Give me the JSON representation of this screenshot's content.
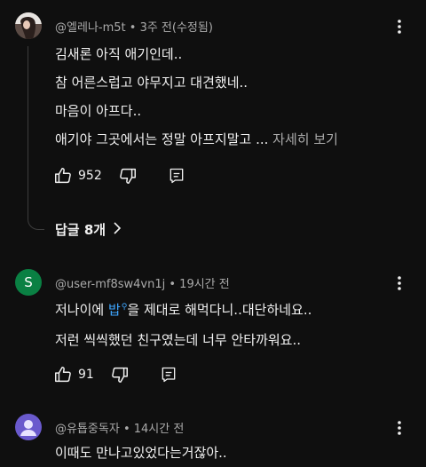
{
  "comments": [
    {
      "author": "@엘레나-m5t",
      "separator": "•",
      "time": "3주 전(수정됨)",
      "lines": [
        "김새론 아직 애기인데..",
        "참  어른스럽고 야무지고 대견했네..",
        "마음이 아프다..",
        "애기야 그곳에서는 정말 아프지말고 ..."
      ],
      "more_label": "자세히 보기",
      "likes": "952",
      "replies_label": "답글 8개",
      "avatar_icon": "photo-avatar"
    },
    {
      "author": "@user-mf8sw4vn1j",
      "separator": "•",
      "time": "19시간 전",
      "avatar_letter": "S",
      "avatar_color": "#0a8043",
      "line1_before": "저나이에 ",
      "line1_link": "밥",
      "line1_after": "을 제대로 해먹다니..대단하네요..",
      "line2": "저런 씩씩했던 친구였는데 너무 안타까워요..",
      "likes": "91"
    },
    {
      "author": "@유툡중독자",
      "separator": "•",
      "time": "14시간 전",
      "avatar_color": "#6a5acd",
      "avatar_icon": "default-person-avatar",
      "line1": "이때도 만나고있었다는거잖아.."
    }
  ],
  "icons": {
    "like": "thumb-up-icon",
    "dislike": "thumb-down-icon",
    "reply": "reply-icon",
    "menu": "more-vertical-icon",
    "chevron": "chevron-right-icon",
    "search": "search-icon"
  },
  "colors": {
    "background": "#0f0f0f",
    "text": "#f1f1f1",
    "secondary_text": "#aaaaaa",
    "link": "#3ea6ff"
  }
}
